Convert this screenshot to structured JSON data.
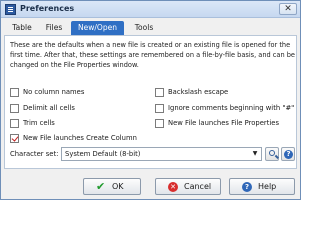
{
  "window": {
    "title": "Preferences",
    "close_glyph": "✕"
  },
  "tabs": [
    {
      "label": "Table",
      "active": false
    },
    {
      "label": "Files",
      "active": false
    },
    {
      "label": "New/Open",
      "active": true
    },
    {
      "label": "Tools",
      "active": false
    }
  ],
  "description": "These are the defaults when a new file is created or an existing file is opened for the first time.  After that, these settings are remembered on a file-by-file basis, and can be changed on the File Properties window.",
  "options": {
    "no_column_names": {
      "label": "No column names",
      "checked": false
    },
    "delimit_all_cells": {
      "label": "Delimit all cells",
      "checked": false
    },
    "trim_cells": {
      "label": "Trim cells",
      "checked": false
    },
    "new_file_create_column": {
      "label": "New File launches Create Column",
      "checked": true
    },
    "backslash_escape": {
      "label": "Backslash escape",
      "checked": false
    },
    "ignore_comments": {
      "label": "Ignore comments beginning with \"#\"",
      "checked": false
    },
    "new_file_properties": {
      "label": "New File launches File Properties",
      "checked": false
    }
  },
  "charset": {
    "label": "Character set:",
    "value": "System Default (8-bit)"
  },
  "icons": {
    "app": "preferences-icon",
    "search": "search-icon",
    "help": "help-icon"
  },
  "buttons": {
    "ok": "OK",
    "cancel": "Cancel",
    "help": "Help"
  },
  "colors": {
    "active_tab": "#2f6fc4",
    "check": "#c02020",
    "ok_icon": "#1f9a2c",
    "cancel_icon": "#d82d2d"
  }
}
